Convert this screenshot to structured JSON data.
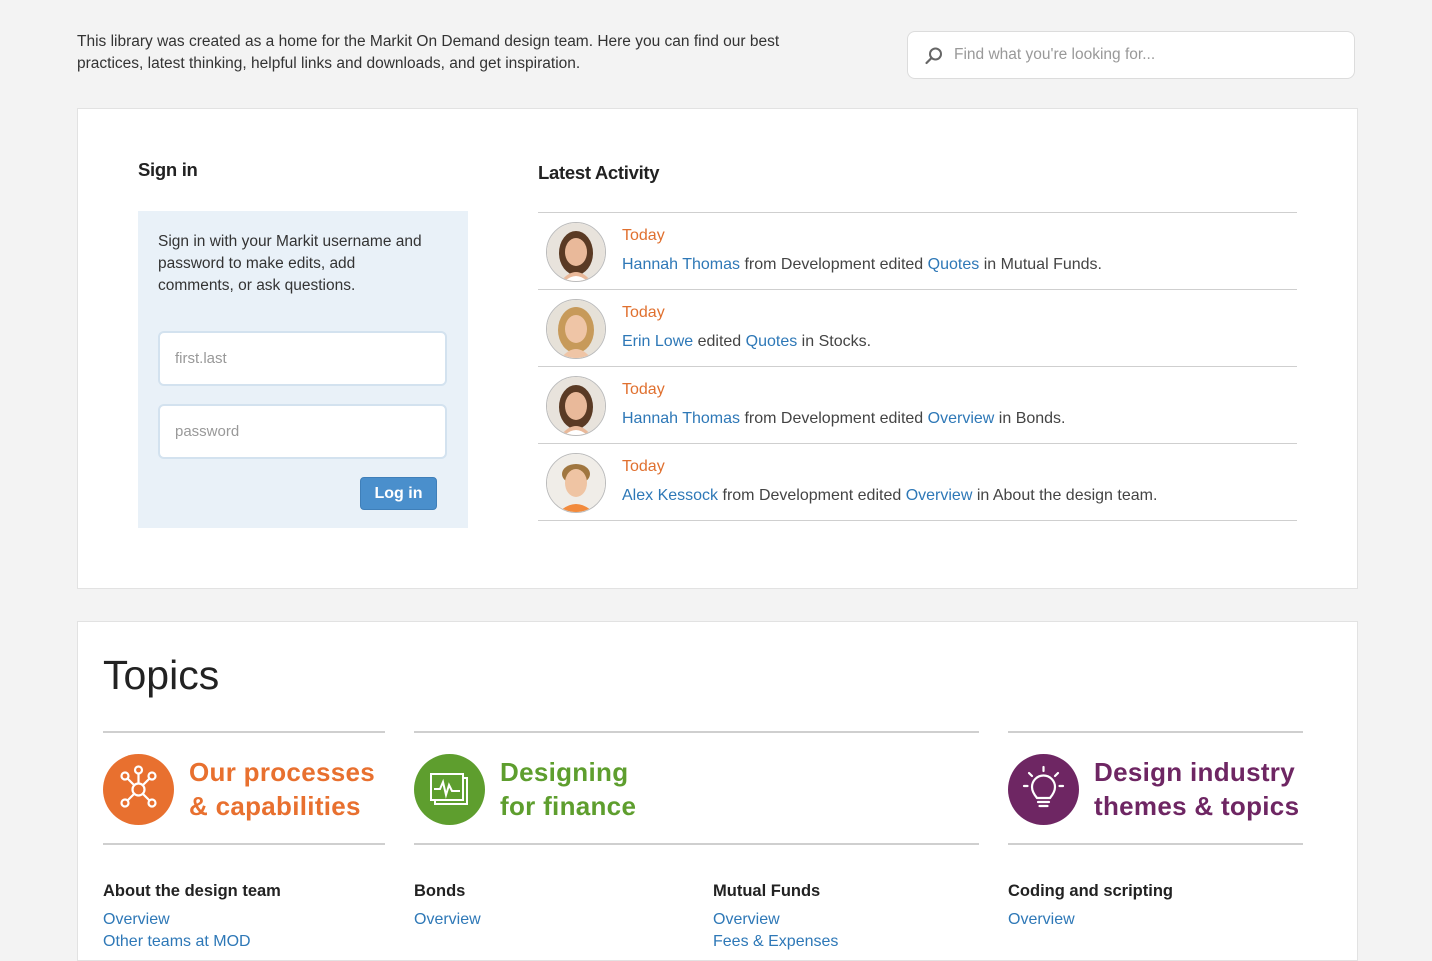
{
  "intro": "This library was created as a home for the Markit On Demand design team. Here you can find our best practices, latest thinking, helpful links and downloads, and get inspiration.",
  "search": {
    "placeholder": "Find what you're looking for..."
  },
  "signin": {
    "title": "Sign in",
    "description": "Sign in with your Markit username and password to make edits, add comments, or ask questions.",
    "username_placeholder": "first.last",
    "password_placeholder": "password",
    "button": "Log in"
  },
  "activity": {
    "title": "Latest Activity",
    "items": [
      {
        "date": "Today",
        "user": "Hannah Thomas",
        "pre": " from Development edited ",
        "page": "Quotes",
        "post": " in Mutual Funds."
      },
      {
        "date": "Today",
        "user": "Erin Lowe",
        "pre": " edited ",
        "page": "Quotes",
        "post": " in Stocks."
      },
      {
        "date": "Today",
        "user": "Hannah Thomas",
        "pre": " from Development edited ",
        "page": "Overview",
        "post": " in Bonds."
      },
      {
        "date": "Today",
        "user": "Alex Kessock",
        "pre": " from Development edited ",
        "page": "Overview",
        "post": " in About the design team."
      }
    ]
  },
  "topics": {
    "title": "Topics",
    "categories": [
      {
        "line1": "Our processes",
        "line2": "& capabilities",
        "color": "#e8702f",
        "icon": "network-icon"
      },
      {
        "line1": "Designing",
        "line2": "for finance",
        "color": "#5e9e2e",
        "icon": "chart-icon"
      },
      {
        "line1": "Design industry",
        "line2": "themes & topics",
        "color": "#6e2663",
        "icon": "lightbulb-icon"
      }
    ],
    "columns": [
      {
        "heading": "About the design team",
        "links": [
          "Overview",
          "Other teams at MOD"
        ]
      },
      {
        "heading": "Bonds",
        "links": [
          "Overview"
        ]
      },
      {
        "heading": "Mutual Funds",
        "links": [
          "Overview",
          "Fees & Expenses"
        ]
      },
      {
        "heading": "Coding and scripting",
        "links": [
          "Overview"
        ]
      }
    ]
  }
}
